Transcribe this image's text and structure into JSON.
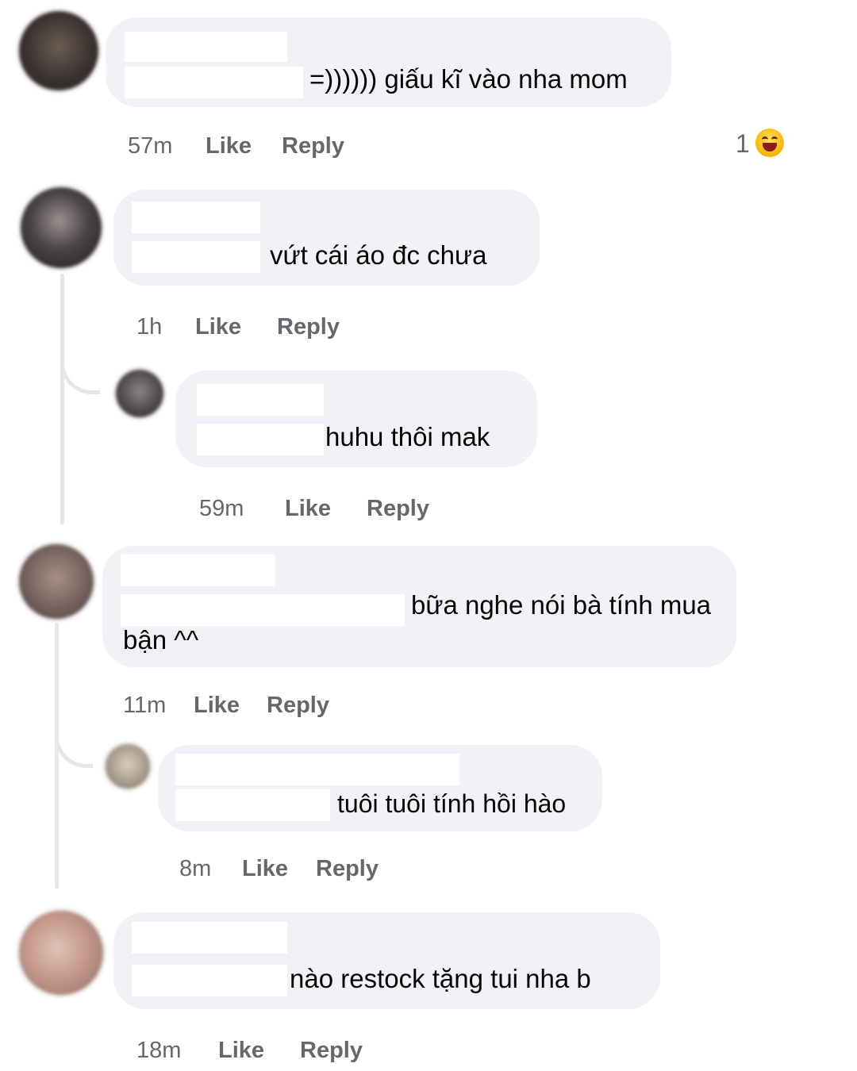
{
  "comments": [
    {
      "text": "=)))))) giấu kĩ vào nha mom",
      "time": "57m",
      "like": "Like",
      "reply": "Reply",
      "reaction_count": "1",
      "reaction_icon": "laughing-emoji"
    },
    {
      "text": "vứt cái áo đc chưa",
      "time": "1h",
      "like": "Like",
      "reply": "Reply"
    },
    {
      "text": "huhu thôi mak",
      "time": "59m",
      "like": "Like",
      "reply": "Reply"
    },
    {
      "text_line1": "bữa nghe nói bà tính mua",
      "text_line2": "bận ^^",
      "time": "11m",
      "like": "Like",
      "reply": "Reply"
    },
    {
      "text": "tuôi tuôi tính hồi hào",
      "time": "8m",
      "like": "Like",
      "reply": "Reply"
    },
    {
      "text": "nào restock tặng tui nha b",
      "time": "18m",
      "like": "Like",
      "reply": "Reply"
    }
  ],
  "colors": {
    "bubble": "#f0f2f5",
    "meta": "#65676b",
    "thread": "#e4e6eb"
  }
}
